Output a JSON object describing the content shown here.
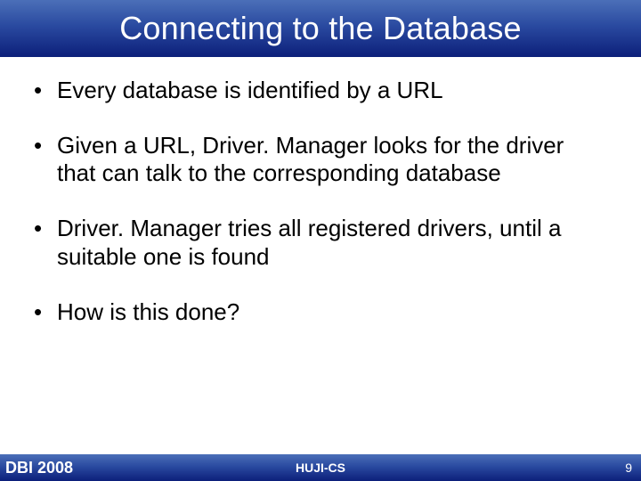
{
  "title": "Connecting to the Database",
  "bullets": [
    "Every database is identified by a URL",
    "Given a URL, Driver. Manager looks for the driver that can talk to the corresponding database",
    "Driver. Manager tries all registered drivers, until a suitable one is found",
    "How is this done?"
  ],
  "footer": {
    "left": "DBI 2008",
    "center": "HUJI-CS",
    "page_number": "9"
  },
  "colors": {
    "banner_gradient_top": "#4b6fb8",
    "banner_gradient_mid": "#2a4aa0",
    "banner_gradient_bottom": "#0c1f7a"
  }
}
